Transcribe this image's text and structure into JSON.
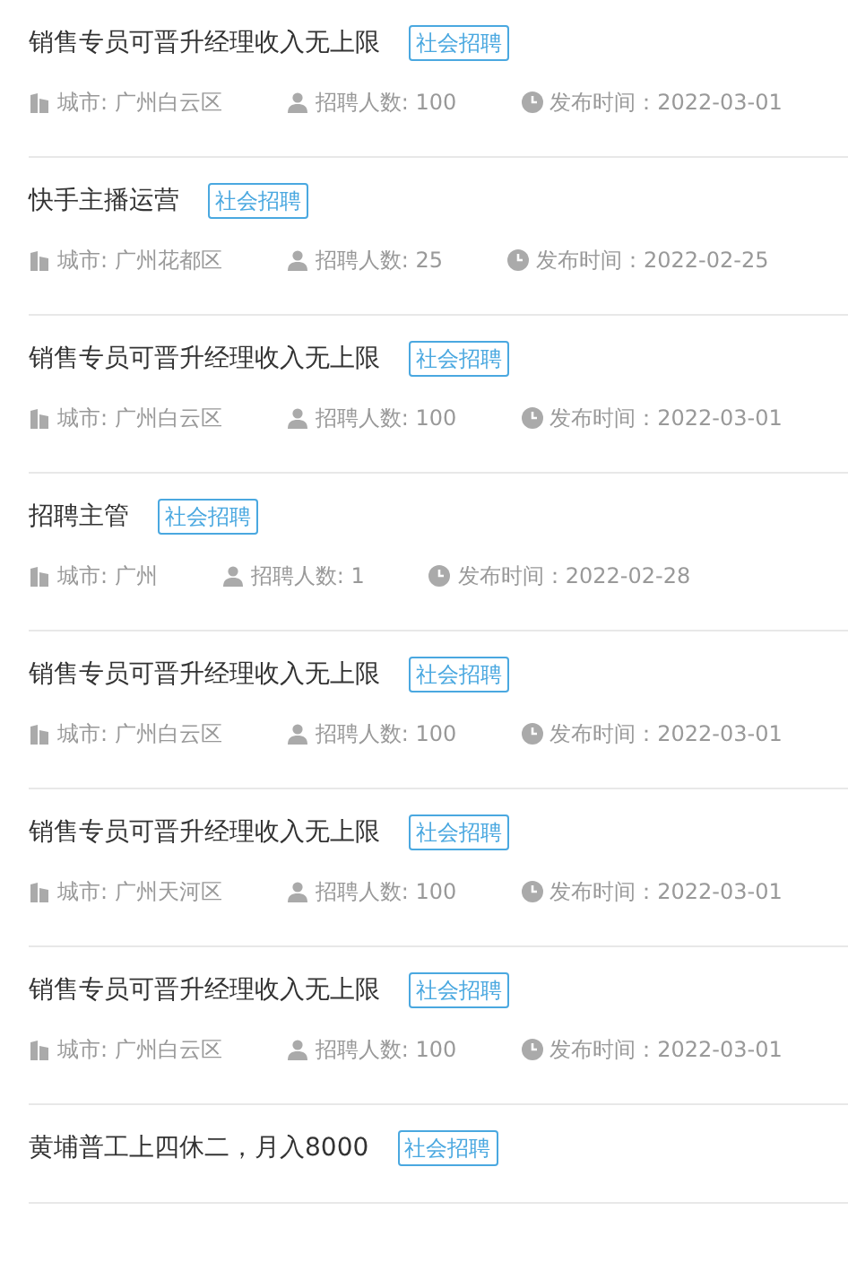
{
  "jobs": [
    {
      "title": "销售专员可晋升经理收入无上限",
      "tag": "社会招聘",
      "city": "城市: 广州白云区",
      "count": "招聘人数: 100",
      "date": "发布时间：2022-03-01"
    },
    {
      "title": "快手主播运营",
      "tag": "社会招聘",
      "city": "城市: 广州花都区",
      "count": "招聘人数: 25",
      "date": "发布时间：2022-02-25"
    },
    {
      "title": "销售专员可晋升经理收入无上限",
      "tag": "社会招聘",
      "city": "城市: 广州白云区",
      "count": "招聘人数: 100",
      "date": "发布时间：2022-03-01"
    },
    {
      "title": "招聘主管",
      "tag": "社会招聘",
      "city": "城市: 广州",
      "count": "招聘人数: 1",
      "date": "发布时间：2022-02-28"
    },
    {
      "title": "销售专员可晋升经理收入无上限",
      "tag": "社会招聘",
      "city": "城市: 广州白云区",
      "count": "招聘人数: 100",
      "date": "发布时间：2022-03-01"
    },
    {
      "title": "销售专员可晋升经理收入无上限",
      "tag": "社会招聘",
      "city": "城市: 广州天河区",
      "count": "招聘人数: 100",
      "date": "发布时间：2022-03-01"
    },
    {
      "title": "销售专员可晋升经理收入无上限",
      "tag": "社会招聘",
      "city": "城市: 广州白云区",
      "count": "招聘人数: 100",
      "date": "发布时间：2022-03-01"
    },
    {
      "title": "黄埔普工上四休二，月入8000",
      "tag": "社会招聘"
    }
  ]
}
